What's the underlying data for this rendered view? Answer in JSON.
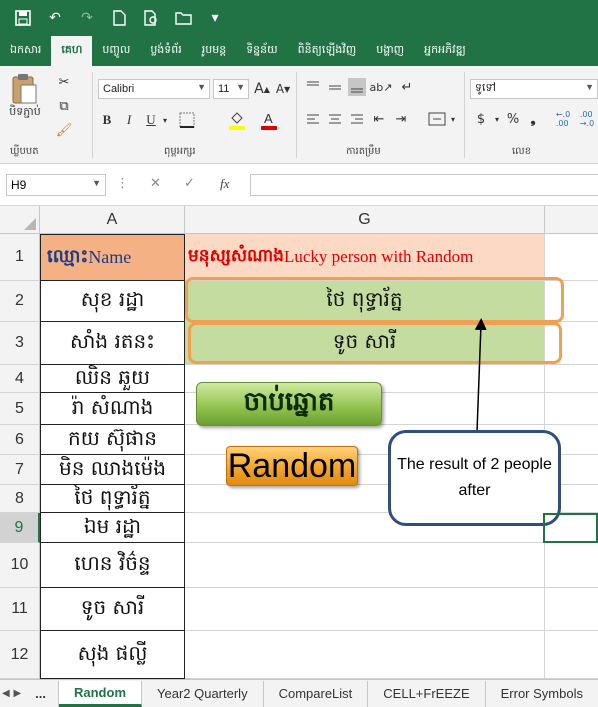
{
  "ribbon_tabs": [
    "ឯកសារ",
    "គេហ",
    "បញ្ចូល",
    "ប្លង់ទំព័រ",
    "រូបមន្ត",
    "ទិន្នន័យ",
    "ពិនិត្យឡើងវិញ",
    "បង្ហាញ",
    "អ្នកអភិវឌ្ឍ"
  ],
  "ribbon": {
    "paste_label": "បិទភ្ជាប់",
    "clipboard_label": "ឃ្លីបបត",
    "font_name": "Calibri",
    "font_size": "11",
    "font_group_label": "ពុម្ពអក្សរ",
    "align_group_label": "ការតម្រឹម",
    "number_format": "ទូទៅ",
    "number_group_label": "លេខ"
  },
  "formula_bar": {
    "name_box": "H9",
    "fx": "fx",
    "value": ""
  },
  "columns": [
    "A",
    "G"
  ],
  "rows": [
    {
      "num": "1",
      "a_kh": "ឈ្មោះ",
      "a_en": " Name",
      "g_kh": "មនុស្សសំណាង",
      "g_en": " Lucky person with Random"
    },
    {
      "num": "2",
      "a": "សុខ រដ្ឋា",
      "g": "ថៃ ពុទ្ធារ័ត្ន"
    },
    {
      "num": "3",
      "a": "សាំង រតនះ",
      "g": "ទូច សារី"
    },
    {
      "num": "4",
      "a": "ឈិន ឆួយ"
    },
    {
      "num": "5",
      "a": "រ៉ា សំណាង"
    },
    {
      "num": "6",
      "a": "កយ ស៊ុផាន"
    },
    {
      "num": "7",
      "a": "មិន ឈាងម៉េង"
    },
    {
      "num": "8",
      "a": "ថៃ ពុទ្ធារ័ត្ន"
    },
    {
      "num": "9",
      "a": "ឯម រដ្ឋា"
    },
    {
      "num": "10",
      "a": "ហេន វិច៌ន្ទ"
    },
    {
      "num": "11",
      "a": "ទូច សារី"
    },
    {
      "num": "12",
      "a": "សុង ផល្លី"
    }
  ],
  "shapes": {
    "khmer_button": "ចាប់ឆ្នោត",
    "random_button": "Random",
    "callout_text": "The result of 2 people after"
  },
  "sheet_tabs": [
    "...",
    "Random",
    "Year2 Quarterly",
    "CompareList",
    "CELL+FrEEZE",
    "Error Symbols"
  ],
  "colors": {
    "excel_green": "#217346",
    "header_orange": "#f4b183",
    "title_fill": "#fbd9c5",
    "result_green": "#c5dca0",
    "red_text": "#e00000",
    "navy_text": "#1f3c88"
  }
}
